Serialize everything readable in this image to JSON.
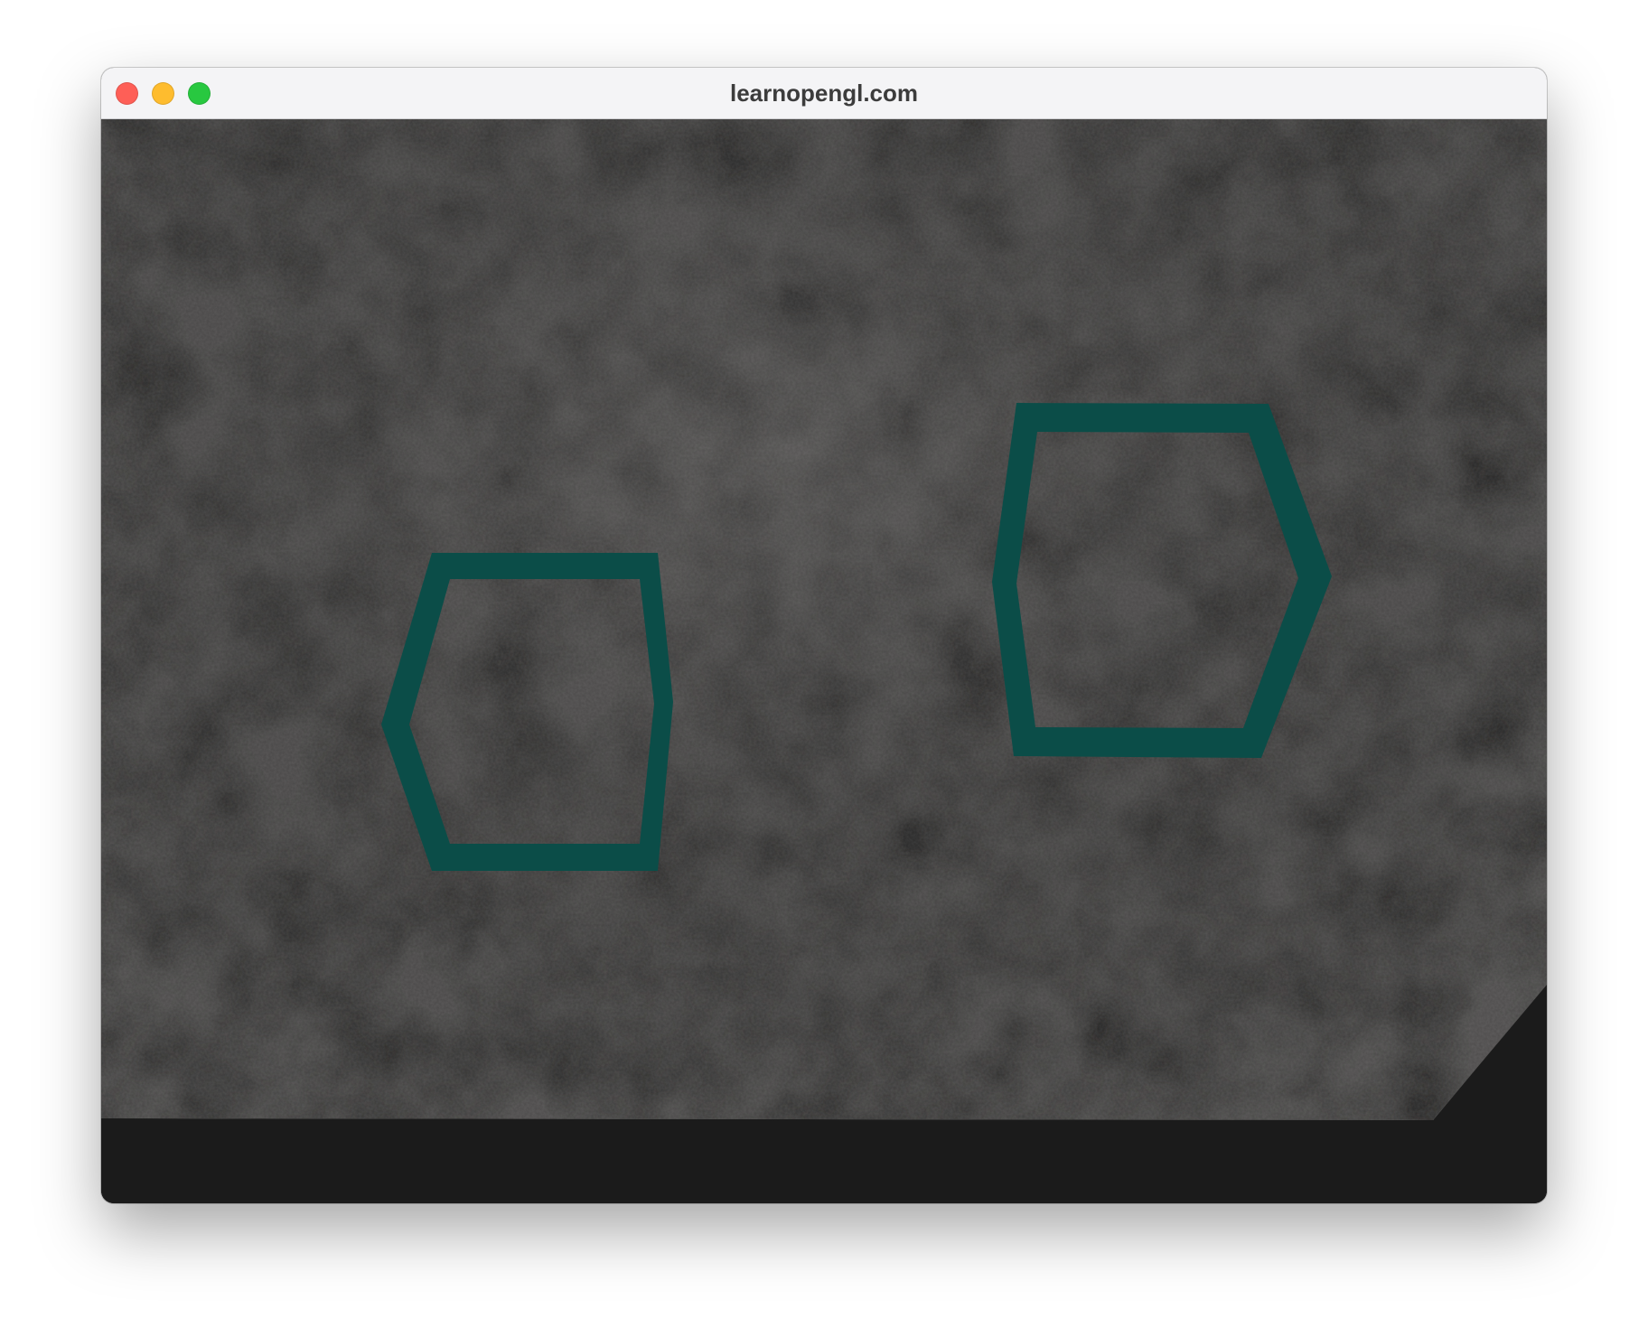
{
  "window": {
    "title": "learnopengl.com"
  },
  "traffic_lights": {
    "close_color": "#fe5f57",
    "minimize_color": "#febc2e",
    "zoom_color": "#28c840"
  },
  "scene": {
    "clear_color": "#1b1b1b",
    "floor_base_color": "#4f4e4d",
    "outline_color": "#0b4d48"
  }
}
